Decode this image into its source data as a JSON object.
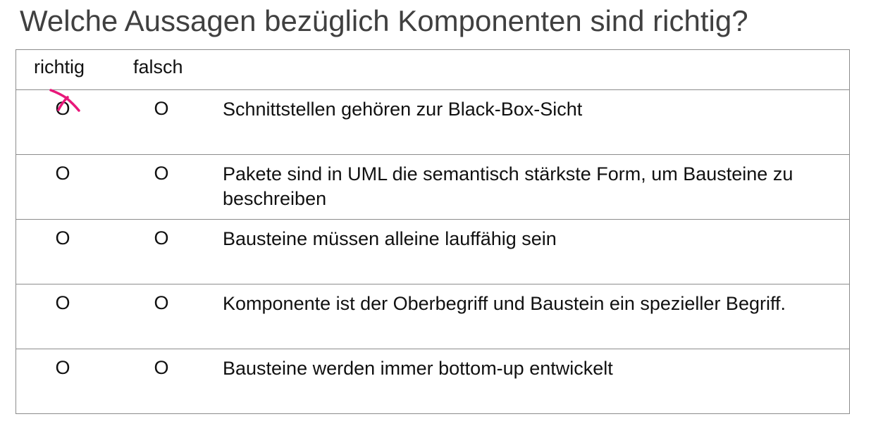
{
  "question": "Welche Aussagen bezüglich Komponenten sind richtig?",
  "headers": {
    "richtig": "richtig",
    "falsch": "falsch"
  },
  "option_symbol": "O",
  "statements": [
    {
      "text": "Schnittstellen gehören zur Black-Box-Sicht",
      "marked": "richtig"
    },
    {
      "text": "Pakete sind in UML die semantisch stärkste Form, um Bausteine zu beschreiben",
      "marked": null
    },
    {
      "text": "Bausteine müssen alleine lauffähig sein",
      "marked": null
    },
    {
      "text": "Komponente ist der Oberbegriff und Baustein ein spezieller Begriff.",
      "marked": null
    },
    {
      "text": "Bausteine werden immer bottom-up entwickelt",
      "marked": null
    }
  ],
  "colors": {
    "title": "#404040",
    "text": "#111111",
    "border": "#8c8c8c",
    "annotation": "#e8187a"
  }
}
